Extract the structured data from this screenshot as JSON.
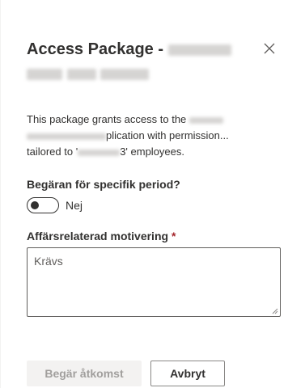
{
  "panel": {
    "title_prefix": "Access Package - ",
    "description": {
      "part1": "This package grants access to the ",
      "part2": "plication with permission...",
      "part3": "tailored to '",
      "part4": "3' employees."
    },
    "close_icon": "close-icon"
  },
  "form": {
    "period_label": "Begäran för specifik period?",
    "period_toggle_value": "Nej",
    "period_toggle_on": false,
    "justification_label": "Affärsrelaterad motivering",
    "required_marker": "*",
    "justification_placeholder": "Krävs"
  },
  "actions": {
    "request_label": "Begär åtkomst",
    "request_disabled": true,
    "cancel_label": "Avbryt"
  },
  "colors": {
    "required": "#a4262c",
    "disabled_text": "#a19f9d",
    "text": "#323130"
  }
}
